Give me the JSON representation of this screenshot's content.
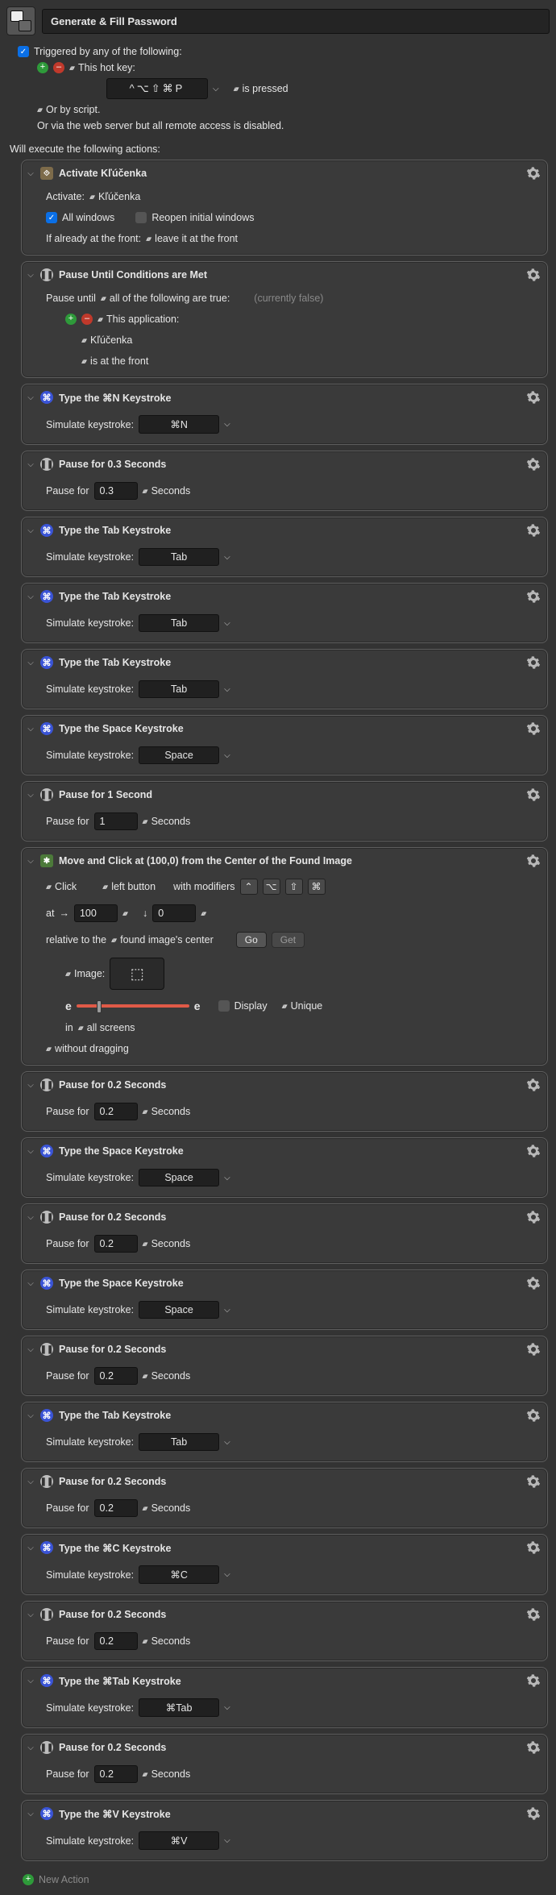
{
  "macro_name": "Generate & Fill Password",
  "triggered_label": "Triggered by any of the following:",
  "hotkey_label": "This hot key:",
  "hotkey_value": "^⌥⇧⌘P",
  "hotkey_cond": "is pressed",
  "or_script": "Or by script.",
  "webserver": "Or via the web server but all remote access is disabled.",
  "exec_label": "Will execute the following actions:",
  "new_action": "New Action",
  "labels": {
    "simulate": "Simulate keystroke:",
    "pause_for": "Pause for",
    "seconds": "Seconds",
    "activate": "Activate:",
    "all_windows": "All windows",
    "reopen": "Reopen initial windows",
    "if_front": "If already at the front:",
    "leave_front": "leave it at the front",
    "pause_until": "Pause until",
    "all_true": "all of the following are true:",
    "currently_false": "(currently false)",
    "this_app": "This application:",
    "is_front": "is at the front",
    "click": "Click",
    "left_button": "left button",
    "with_mod": "with modifiers",
    "at": "at",
    "relative": "relative to the",
    "found_center": "found image's center",
    "image": "Image:",
    "display": "Display",
    "unique": "Unique",
    "in": "in",
    "all_screens": "all screens",
    "no_drag": "without dragging",
    "go": "Go",
    "get": "Get"
  },
  "actions": [
    {
      "type": "activate",
      "title": "Activate Kľúčenka",
      "app": "Kľúčenka",
      "all_windows": true,
      "reopen": false
    },
    {
      "type": "pause_cond",
      "title": "Pause Until Conditions are Met",
      "app": "Kľúčenka"
    },
    {
      "type": "key",
      "title": "Type the ⌘N Keystroke",
      "key": "⌘N"
    },
    {
      "type": "pause",
      "title": "Pause for 0.3 Seconds",
      "val": "0.3"
    },
    {
      "type": "key",
      "title": "Type the Tab Keystroke",
      "key": "Tab"
    },
    {
      "type": "key",
      "title": "Type the Tab Keystroke",
      "key": "Tab"
    },
    {
      "type": "key",
      "title": "Type the Tab Keystroke",
      "key": "Tab"
    },
    {
      "type": "key",
      "title": "Type the Space Keystroke",
      "key": "Space"
    },
    {
      "type": "pause",
      "title": "Pause for 1 Second",
      "val": "1"
    },
    {
      "type": "mouse",
      "title": "Move and Click at (100,0) from the Center of the Found Image",
      "x": "100",
      "y": "0"
    },
    {
      "type": "pause",
      "title": "Pause for 0.2 Seconds",
      "val": "0.2"
    },
    {
      "type": "key",
      "title": "Type the Space Keystroke",
      "key": "Space"
    },
    {
      "type": "pause",
      "title": "Pause for 0.2 Seconds",
      "val": "0.2"
    },
    {
      "type": "key",
      "title": "Type the Space Keystroke",
      "key": "Space"
    },
    {
      "type": "pause",
      "title": "Pause for 0.2 Seconds",
      "val": "0.2"
    },
    {
      "type": "key",
      "title": "Type the Tab Keystroke",
      "key": "Tab"
    },
    {
      "type": "pause",
      "title": "Pause for 0.2 Seconds",
      "val": "0.2"
    },
    {
      "type": "key",
      "title": "Type the ⌘C Keystroke",
      "key": "⌘C"
    },
    {
      "type": "pause",
      "title": "Pause for 0.2 Seconds",
      "val": "0.2"
    },
    {
      "type": "key",
      "title": "Type the ⌘Tab Keystroke",
      "key": "⌘Tab"
    },
    {
      "type": "pause",
      "title": "Pause for 0.2 Seconds",
      "val": "0.2"
    },
    {
      "type": "key",
      "title": "Type the ⌘V Keystroke",
      "key": "⌘V"
    }
  ]
}
